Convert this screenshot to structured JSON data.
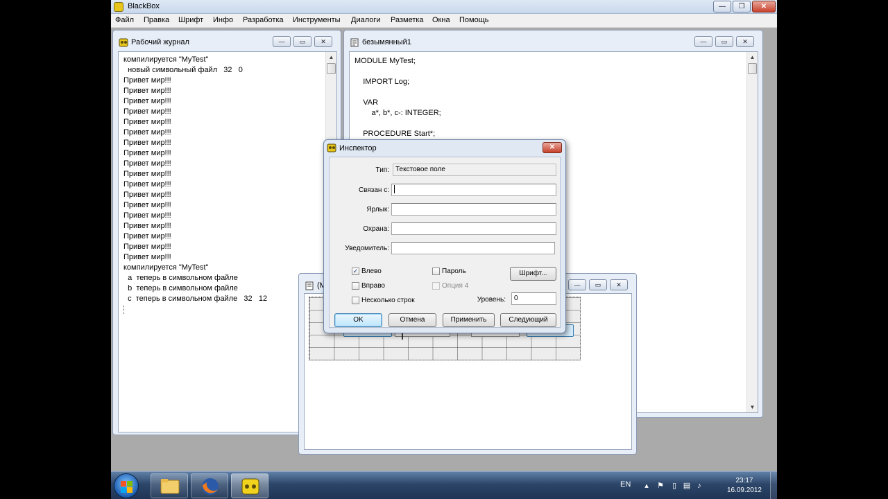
{
  "app": {
    "title": "BlackBox"
  },
  "menu": [
    "Файл",
    "Правка",
    "Шрифт",
    "Инфо",
    "Разработка",
    "Инструменты",
    "Диалоги",
    "Разметка",
    "Окна",
    "Помощь"
  ],
  "log_window": {
    "title": "Рабочий журнал",
    "lines": [
      "компилируется \"MyTest\"",
      "  новый символьный файл   32   0",
      "Привет мир!!!",
      "Привет мир!!!",
      "Привет мир!!!",
      "Привет мир!!!",
      "Привет мир!!!",
      "Привет мир!!!",
      "Привет мир!!!",
      "Привет мир!!!",
      "Привет мир!!!",
      "Привет мир!!!",
      "Привет мир!!!",
      "Привет мир!!!",
      "Привет мир!!!",
      "Привет мир!!!",
      "Привет мир!!!",
      "Привет мир!!!",
      "Привет мир!!!",
      "Привет мир!!!",
      "компилируется \"MyTest\"",
      "  a  теперь в символьном файле",
      "  b  теперь в символьном файле",
      "  c  теперь в символьном файле   32   12"
    ]
  },
  "editor_window": {
    "title": "безымянный1",
    "lines": [
      "MODULE MyTest;",
      "",
      "    IMPORT Log;",
      "",
      "    VAR",
      "        a*, b*, c-: INTEGER;",
      "",
      "    PROCEDURE Start*;"
    ]
  },
  "form_window": {
    "title": "(M"
  },
  "inspector": {
    "title": "Инспектор",
    "fields": {
      "type_label": "Тип:",
      "type_value": "Текстовое поле",
      "link_label": "Связан с:",
      "link_value": "",
      "label_label": "Ярлык:",
      "label_value": "",
      "guard_label": "Охрана:",
      "guard_value": "",
      "notifier_label": "Уведомитель:",
      "notifier_value": ""
    },
    "checkboxes": {
      "left": {
        "label": "Влево",
        "checked": true
      },
      "right": {
        "label": "Вправо",
        "checked": false
      },
      "multiline": {
        "label": "Несколько строк",
        "checked": false
      },
      "password": {
        "label": "Пароль",
        "checked": false
      },
      "option4": {
        "label": "Опция 4",
        "checked": false
      }
    },
    "font_button": "Шрифт...",
    "level_label": "Уровень:",
    "level_value": "0",
    "buttons": {
      "ok": "OK",
      "cancel": "Отмена",
      "apply": "Применить",
      "next": "Следующий"
    }
  },
  "taskbar": {
    "language": "EN",
    "time": "23:17",
    "date": "16.09.2012"
  },
  "colors": {
    "desktop": "#abaaaa",
    "accent": "#3c7fb1",
    "taskbar": "#2c4669"
  }
}
